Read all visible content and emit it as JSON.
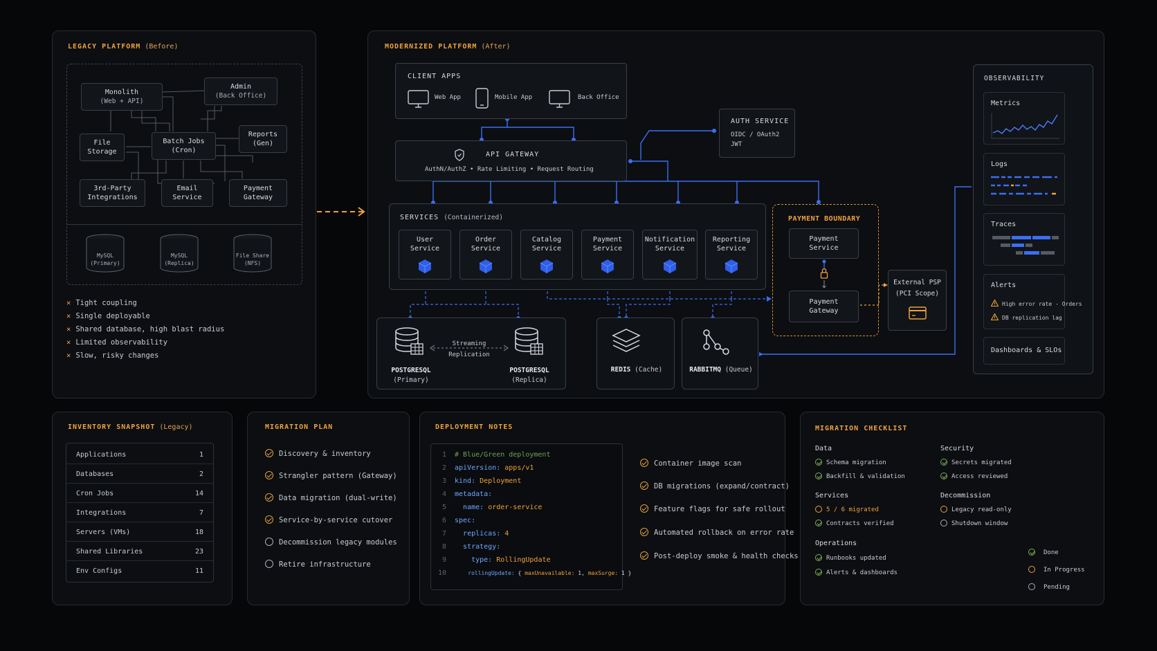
{
  "legacy": {
    "title": "LEGACY PLATFORM",
    "title_sub": "(Before)",
    "boxes": {
      "monolith": [
        "Monolith",
        "(Web + API)"
      ],
      "admin": [
        "Admin",
        "(Back Office)"
      ],
      "file_storage": [
        "File",
        "Storage"
      ],
      "batch_jobs": [
        "Batch Jobs",
        "(Cron)"
      ],
      "reports": [
        "Reports",
        "(Gen)"
      ],
      "third_party": [
        "3rd-Party",
        "Integrations"
      ],
      "email": [
        "Email",
        "Service"
      ],
      "payment": [
        "Payment",
        "Gateway"
      ]
    },
    "dbs": [
      [
        "MySQL",
        "(Primary)"
      ],
      [
        "MySQL",
        "(Replica)"
      ],
      [
        "File Share",
        "(NFS)"
      ]
    ],
    "issues": [
      "Tight coupling",
      "Single deployable",
      "Shared database, high blast radius",
      "Limited observability",
      "Slow, risky changes"
    ]
  },
  "modern": {
    "title": "MODERNIZED PLATFORM",
    "title_sub": "(After)",
    "client_apps": {
      "title": "CLIENT APPS",
      "items": [
        "Web App",
        "Mobile App",
        "Back Office"
      ]
    },
    "auth": {
      "title": "AUTH SERVICE",
      "l1": "OIDC / OAuth2",
      "l2": "JWT"
    },
    "gateway": {
      "title": "API GATEWAY",
      "sub": "AuthN/AuthZ • Rate Limiting • Request Routing"
    },
    "services": {
      "title": "SERVICES",
      "title_sub": "(Containerized)",
      "items": [
        [
          "User",
          "Service"
        ],
        [
          "Order",
          "Service"
        ],
        [
          "Catalog",
          "Service"
        ],
        [
          "Payment",
          "Service"
        ],
        [
          "Notification",
          "Service"
        ],
        [
          "Reporting",
          "Service"
        ]
      ]
    },
    "payment_boundary": {
      "title": "PAYMENT BOUNDARY",
      "svc": [
        "Payment",
        "Service"
      ],
      "gw": [
        "Payment",
        "Gateway"
      ]
    },
    "external_psp": [
      "External PSP",
      "(PCI Scope)"
    ],
    "data": {
      "pg_primary": [
        "POSTGRESQL",
        "(Primary)"
      ],
      "pg_replica": [
        "POSTGRESQL",
        "(Replica)"
      ],
      "streaming": [
        "Streaming",
        "Replication"
      ],
      "redis": [
        "REDIS",
        "(Cache)"
      ],
      "rabbit": [
        "RABBITMQ",
        "(Queue)"
      ]
    },
    "observability": {
      "title": "OBSERVABILITY",
      "metrics": "Metrics",
      "logs": "Logs",
      "traces": "Traces",
      "alerts": "Alerts",
      "alert_items": [
        "High error rate - Orders",
        "DB replication lag"
      ],
      "dashboards": "Dashboards & SLOs"
    }
  },
  "inventory": {
    "title": "INVENTORY SNAPSHOT",
    "title_sub": "(Legacy)",
    "rows": [
      [
        "Applications",
        "1"
      ],
      [
        "Databases",
        "2"
      ],
      [
        "Cron Jobs",
        "14"
      ],
      [
        "Integrations",
        "7"
      ],
      [
        "Servers (VMs)",
        "18"
      ],
      [
        "Shared Libraries",
        "23"
      ],
      [
        "Env Configs",
        "11"
      ]
    ]
  },
  "plan": {
    "title": "MIGRATION PLAN",
    "items": [
      {
        "label": "Discovery & inventory",
        "state": "done"
      },
      {
        "label": "Strangler pattern (Gateway)",
        "state": "done"
      },
      {
        "label": "Data migration (dual-write)",
        "state": "done"
      },
      {
        "label": "Service-by-service cutover",
        "state": "done"
      },
      {
        "label": "Decommission legacy modules",
        "state": "pending"
      },
      {
        "label": "Retire infrastructure",
        "state": "pending"
      }
    ]
  },
  "deploy": {
    "title": "DEPLOYMENT NOTES",
    "code": {
      "l1": "# Blue/Green deployment",
      "l2k": "apiVersion:",
      "l2v": "apps/v1",
      "l3k": "kind:",
      "l3v": "Deployment",
      "l4k": "metadata:",
      "l5k": "name:",
      "l5v": "order-service",
      "l6k": "spec:",
      "l7k": "replicas:",
      "l7v": "4",
      "l8k": "strategy:",
      "l9k": "type:",
      "l9v": "RollingUpdate",
      "l10k": "rollingUpdate:",
      "l10a": "{",
      "l10b": "maxUnavailable:",
      "l10c": "1,",
      "l10d": "maxSurge:",
      "l10e": "1",
      "l10f": "}"
    },
    "checks": [
      "Container image scan",
      "DB migrations (expand/contract)",
      "Feature flags for safe rollout",
      "Automated rollback on error rate",
      "Post-deploy smoke & health checks"
    ]
  },
  "checklist": {
    "title": "MIGRATION CHECKLIST",
    "data_h": "Data",
    "data_items": [
      "Schema migration",
      "Backfill & validation"
    ],
    "security_h": "Security",
    "security_items": [
      "Secrets migrated",
      "Access reviewed"
    ],
    "services_h": "Services",
    "services_items": [
      "5 / 6 migrated",
      "Contracts verified"
    ],
    "decom_h": "Decommission",
    "decom_items": [
      "Legacy read-only",
      "Shutdown window"
    ],
    "ops_h": "Operations",
    "ops_items": [
      "Runbooks updated",
      "Alerts & dashboards"
    ],
    "legend": [
      "Done",
      "In Progress",
      "Pending"
    ]
  },
  "colors": {
    "accent": "#f0a23a",
    "blue": "#3b6ff2",
    "green": "#7fae57"
  }
}
